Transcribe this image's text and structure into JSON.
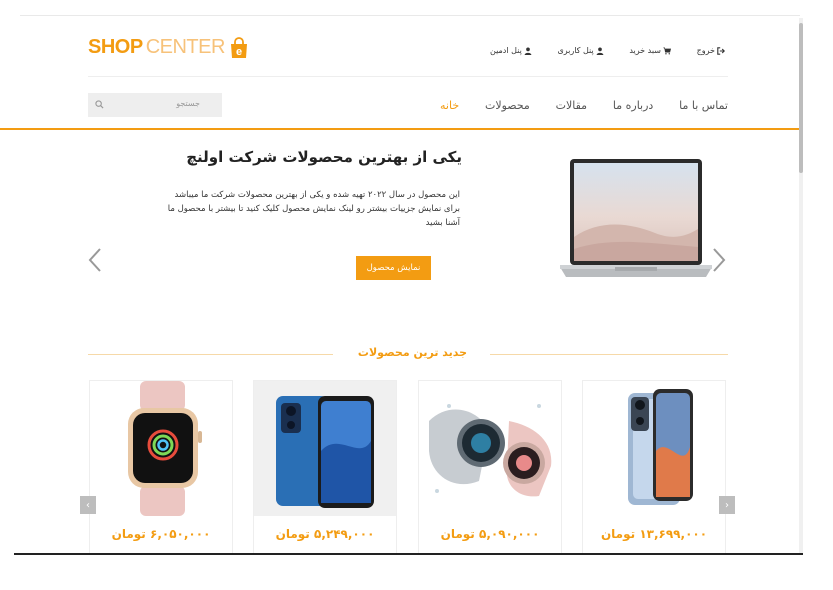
{
  "header": {
    "logo_shop": "SHOP",
    "logo_center": "CENTER",
    "logo_letter": "e",
    "top_links": [
      {
        "label": "خروج",
        "icon": "logout-icon"
      },
      {
        "label": "سبد خرید",
        "icon": "cart-icon"
      },
      {
        "label": "پنل کاربری",
        "icon": "user-icon"
      },
      {
        "label": "پنل ادمین",
        "icon": "user-icon"
      }
    ]
  },
  "nav": {
    "items": [
      "خانه",
      "محصولات",
      "مقالات",
      "درباره ما",
      "تماس با ما"
    ],
    "active_index": 0
  },
  "search": {
    "placeholder": "جستجو"
  },
  "hero": {
    "title": "یکی از بهترین محصولات شرکت اولنچ",
    "description": "این محصول در سال ۲۰۲۲ تهیه شده و یکی از بهترین محصولات شرکت ما میباشد برای نمایش جزییات بیشتر رو لینک نمایش محصول کلیک کنید تا بیشتر با محصول ما آشنا بشید",
    "button_label": "نمایش محصول",
    "image": "laptop"
  },
  "products_section": {
    "title": "جدید ترین محصولات",
    "products": [
      {
        "image": "apple-watch-pink",
        "price": "۶,۰۵۰,۰۰۰ تومان"
      },
      {
        "image": "blue-smartphone",
        "price": "۵,۲۴۹,۰۰۰ تومان"
      },
      {
        "image": "smartwatches-splash",
        "price": "۵,۰۹۰,۰۰۰ تومان"
      },
      {
        "image": "xiaomi-phone",
        "price": "۱۳,۶۹۹,۰۰۰ تومان"
      }
    ]
  },
  "colors": {
    "accent": "#f39c12",
    "text": "#333333",
    "nav_text": "#555555"
  }
}
